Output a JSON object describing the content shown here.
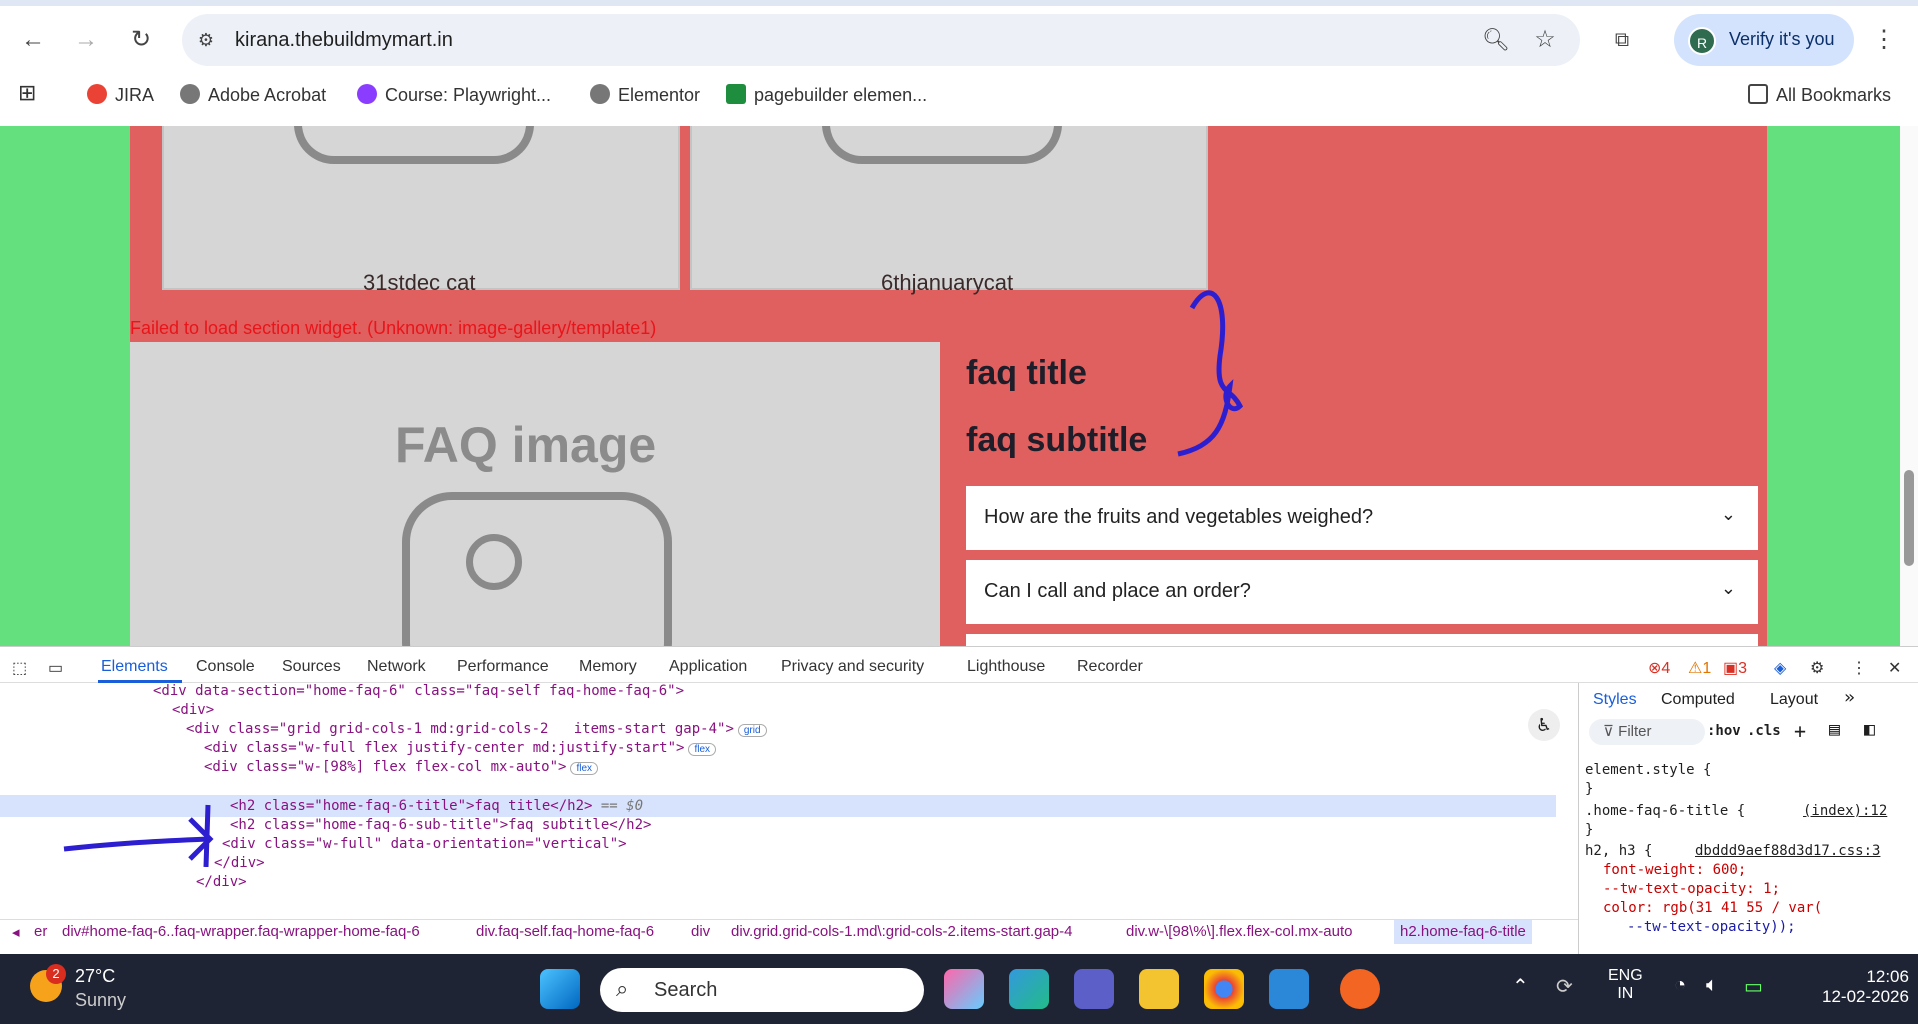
{
  "browser": {
    "url": "kirana.thebuildmymart.in",
    "verify": "Verify it's you",
    "avatar": "R",
    "bookmarks": [
      "JIRA",
      "Adobe Acrobat",
      "Course: Playwright...",
      "Elementor",
      "pagebuilder elemen..."
    ],
    "all_bookmarks": "All Bookmarks"
  },
  "page": {
    "cat1": "31stdec cat",
    "cat2": "6thjanuarycat",
    "error": "Failed to load section widget. (Unknown: image-gallery/template1)",
    "faq_image_label": "FAQ image",
    "faq_title": "faq title",
    "faq_subtitle": "faq subtitle",
    "faq_items": [
      "How are the fruits and vegetables weighed?",
      "Can I call and place an order?"
    ]
  },
  "devtools": {
    "tabs": [
      "Elements",
      "Console",
      "Sources",
      "Network",
      "Performance",
      "Memory",
      "Application",
      "Privacy and security",
      "Lighthouse",
      "Recorder"
    ],
    "errors": "4",
    "warnings": "1",
    "issues": "3",
    "code": [
      "<div data-section=\"home-faq-6\" class=\"faq-self faq-home-faq-6\">",
      "<div>",
      "<div class=\"grid grid-cols-1 md:grid-cols-2   items-start gap-4\">",
      "<div class=\"w-full flex justify-center md:justify-start\">",
      "<div class=\"w-[98%] flex flex-col mx-auto\">",
      "<h2 class=\"home-faq-6-title\">faq title</h2>",
      "<h2 class=\"home-faq-6-sub-title\">faq subtitle</h2>",
      "<div class=\"w-full\" data-orientation=\"vertical\">",
      "</div>",
      "</div>",
      "</div>"
    ],
    "selected_suffix": " == $0",
    "pill_grid": "grid",
    "pill_flex": "flex",
    "styles_tabs": [
      "Styles",
      "Computed",
      "Layout"
    ],
    "filter": "Filter",
    "hov": ":hov",
    "cls": ".cls",
    "styles": [
      "element.style {",
      "}",
      ".home-faq-6-title {",
      "(index):12",
      "}",
      "h2, h3 {",
      "dbddd9aef88d3d17.css:3",
      "font-weight: 600;",
      "--tw-text-opacity: 1;",
      "color: rgb(31 41 55 / var(",
      "--tw-text-opacity));"
    ],
    "crumbs": [
      "er",
      "div#home-faq-6..faq-wrapper.faq-wrapper-home-faq-6",
      "div.faq-self.faq-home-faq-6",
      "div",
      "div.grid.grid-cols-1.md\\:grid-cols-2.items-start.gap-4",
      "div.w-\\[98\\%\\].flex.flex-col.mx-auto",
      "h2.home-faq-6-title"
    ]
  },
  "taskbar": {
    "temp": "27°C",
    "weather": "Sunny",
    "badge": "2",
    "search": "Search",
    "lang1": "ENG",
    "lang2": "IN",
    "time": "12:06",
    "date": "12-02-2026"
  },
  "colors": {
    "page_bg": "#64e07f",
    "section_bg": "#e05f5f",
    "accent": "#1a5ed9"
  }
}
